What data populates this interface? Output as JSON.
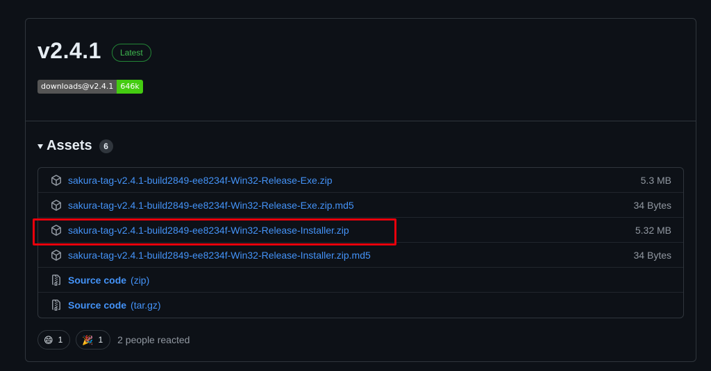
{
  "release": {
    "version": "v2.4.1",
    "latest_label": "Latest",
    "downloads_badge": {
      "label": "downloads@v2.4.1",
      "value": "646k"
    }
  },
  "assets": {
    "title": "Assets",
    "count": "6",
    "items": [
      {
        "name": "sakura-tag-v2.4.1-build2849-ee8234f-Win32-Release-Exe.zip",
        "size": "5.3 MB",
        "icon": "package-icon"
      },
      {
        "name": "sakura-tag-v2.4.1-build2849-ee8234f-Win32-Release-Exe.zip.md5",
        "size": "34 Bytes",
        "icon": "package-icon"
      },
      {
        "name": "sakura-tag-v2.4.1-build2849-ee8234f-Win32-Release-Installer.zip",
        "size": "5.32 MB",
        "icon": "package-icon"
      },
      {
        "name": "sakura-tag-v2.4.1-build2849-ee8234f-Win32-Release-Installer.zip.md5",
        "size": "34 Bytes",
        "icon": "package-icon"
      },
      {
        "name": "Source code",
        "suffix": "(zip)",
        "icon": "file-zip-icon"
      },
      {
        "name": "Source code",
        "suffix": "(tar.gz)",
        "icon": "file-zip-icon"
      }
    ]
  },
  "reactions": {
    "items": [
      {
        "emoji": "😄",
        "count": "1",
        "icon": "smile-emoji"
      },
      {
        "emoji": "🎉",
        "count": "1",
        "icon": "tada-emoji"
      }
    ],
    "summary": "2 people reacted"
  },
  "colors": {
    "background": "#0d1117",
    "link": "#4493f8",
    "latest_green": "#3fb950",
    "highlight_red": "#e8000b"
  }
}
